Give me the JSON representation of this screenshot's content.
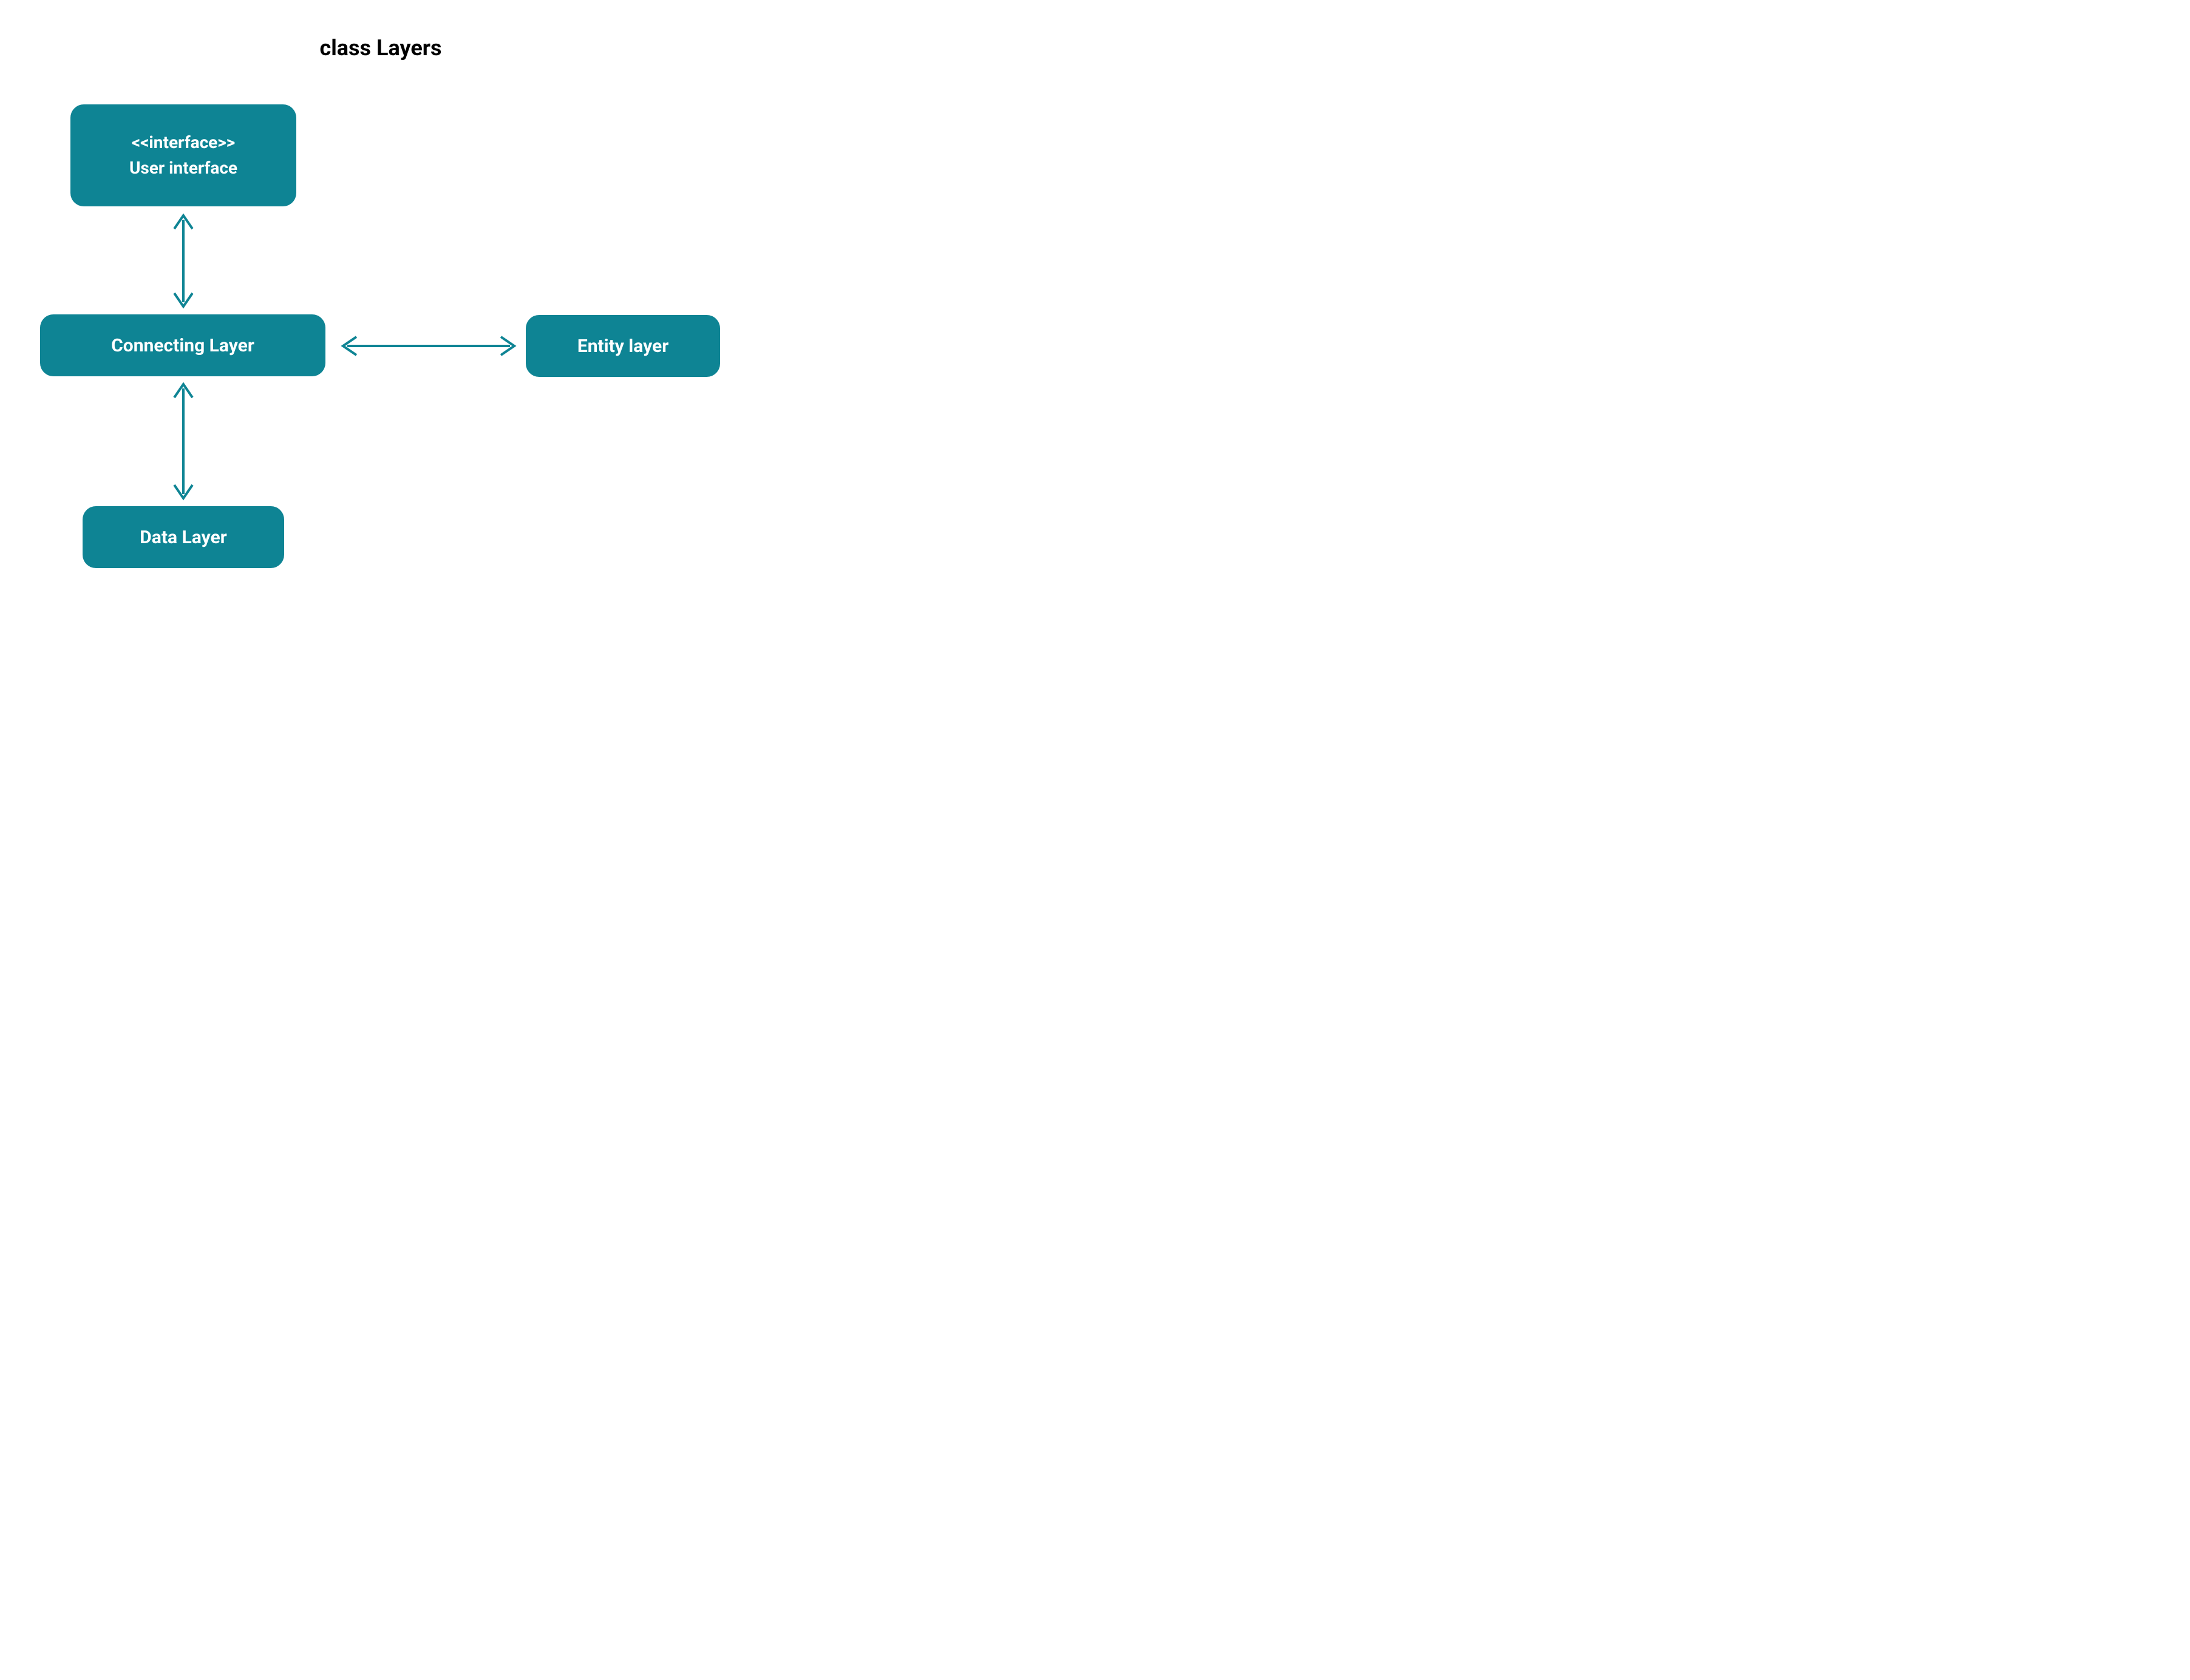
{
  "title": "class Layers",
  "colors": {
    "node_fill": "#0e8494",
    "node_text": "#ffffff",
    "arrow": "#0e8494",
    "title": "#000000"
  },
  "nodes": {
    "user_interface": {
      "stereotype": "<<interface>>",
      "name": "User interface"
    },
    "connecting_layer": {
      "name": "Connecting Layer"
    },
    "entity_layer": {
      "name": "Entity layer"
    },
    "data_layer": {
      "name": "Data Layer"
    }
  },
  "edges": [
    {
      "from": "user_interface",
      "to": "connecting_layer",
      "bidirectional": true
    },
    {
      "from": "connecting_layer",
      "to": "entity_layer",
      "bidirectional": true
    },
    {
      "from": "connecting_layer",
      "to": "data_layer",
      "bidirectional": true
    }
  ]
}
